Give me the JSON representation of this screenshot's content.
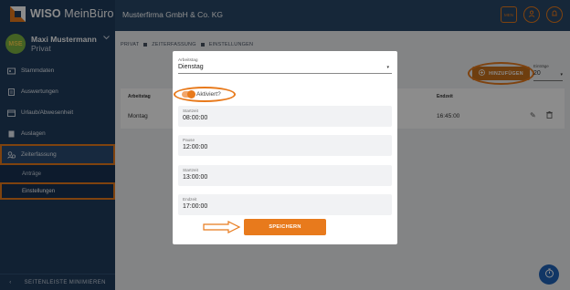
{
  "brand": {
    "name_bold": "WISO",
    "name_light": " MeinBüro"
  },
  "user": {
    "initials": "MSE",
    "name": "Maxi Mustermann",
    "role": "Privat"
  },
  "sidebar": {
    "items": [
      {
        "label": "Stammdaten",
        "icon": "id-card-icon"
      },
      {
        "label": "Auswertungen",
        "icon": "document-icon"
      },
      {
        "label": "Urlaub/Abwesenheit",
        "icon": "calendar-icon"
      },
      {
        "label": "Auslagen",
        "icon": "receipt-icon"
      },
      {
        "label": "Zeiterfassung",
        "icon": "clock-person-icon"
      }
    ],
    "subitems": [
      {
        "label": "Anträge"
      },
      {
        "label": "Einstellungen"
      }
    ],
    "minimize_label": "SEITENLEISTE MINIMIEREN"
  },
  "header": {
    "company": "Musterfirma GmbH & Co. KG",
    "menu_badge": "MEN"
  },
  "breadcrumb": [
    "PRIVAT",
    "ZEITERFASSUNG",
    "EINSTELLUNGEN"
  ],
  "toolbar": {
    "add_label": "HINZUFÜGEN",
    "entries_label": "Einträge",
    "entries_value": "20"
  },
  "table": {
    "headers": [
      "Arbeitstag",
      "Endzeit"
    ],
    "row": {
      "day": "Montag",
      "end": "16:45:00"
    }
  },
  "modal": {
    "day_label": "Arbeitstag",
    "day_value": "Dienstag",
    "toggle_label": "Aktiviert?",
    "fields": [
      {
        "label": "Startzeit",
        "value": "08:00:00"
      },
      {
        "label": "Pause",
        "value": "12:00:00"
      },
      {
        "label": "Startzeit",
        "value": "13:00:00"
      },
      {
        "label": "Endzeit",
        "value": "17:00:00"
      }
    ],
    "save_label": "SPEICHERN"
  },
  "colors": {
    "accent": "#e87a1c",
    "sidebar": "#1f3c5e",
    "header": "#284869",
    "fab": "#1f63b8"
  }
}
